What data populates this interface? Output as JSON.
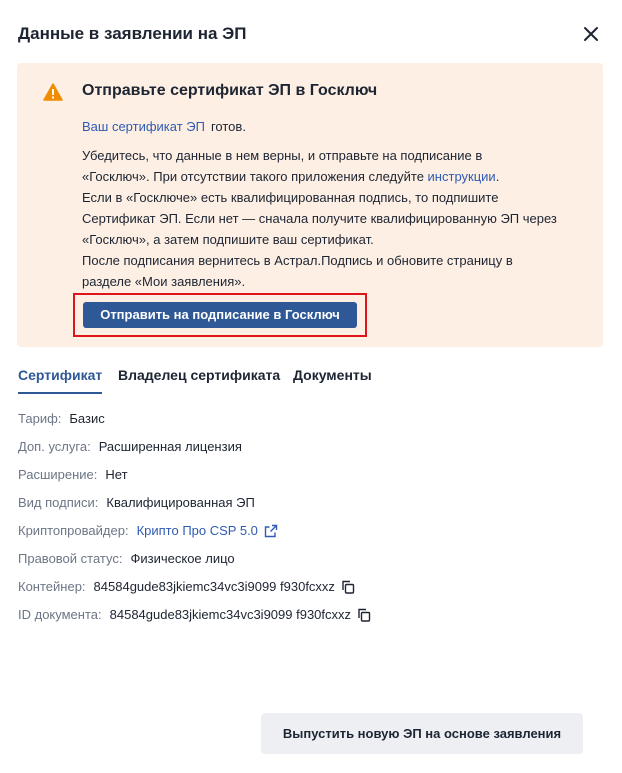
{
  "header": {
    "title": "Данные в заявлении на ЭП"
  },
  "alert": {
    "title": "Отправьте сертификат ЭП в Госключ",
    "cert_link": "Ваш сертификат ЭП",
    "cert_ready": "готов.",
    "line1_a": "Убедитесь, что данные в нем верны, и отправьте на подписание в",
    "line1_b": "«Госключ». При отсутствии такого приложения следуйте ",
    "instructions_link": "инструкции",
    "line1_end": ".",
    "line2": "Если в «Госключе» есть квалифицированная подпись, то подпишите Сертификат ЭП. Если нет — сначала получите квалифицированную ЭП через «Госключ», а затем подпишите ваш сертификат.",
    "line3": "После подписания вернитесь в Астрал.Подпись и обновите страницу в разделе «Мои заявления».",
    "send_button": "Отправить на подписание в Госключ"
  },
  "tabs": [
    {
      "label": "Сертификат",
      "active": true
    },
    {
      "label": "Владелец сертификата",
      "active": false
    },
    {
      "label": "Документы",
      "active": false
    }
  ],
  "info": {
    "tariff": {
      "label": "Тариф:",
      "value": "Базис"
    },
    "addon": {
      "label": "Доп. услуга:",
      "value": "Расширенная лицензия"
    },
    "extension": {
      "label": "Расширение:",
      "value": "Нет"
    },
    "signature": {
      "label": "Вид подписи:",
      "value": "Квалифицированная ЭП"
    },
    "crypto": {
      "label": "Криптопровайдер:",
      "value": "Крипто Про CSP 5.0"
    },
    "legal": {
      "label": "Правовой статус:",
      "value": "Физическое лицо"
    },
    "container": {
      "label": "Контейнер:",
      "value": "84584gude83jkiemc34vc3i9099 f930fcxxz"
    },
    "doc_id": {
      "label": "ID документа:",
      "value": "84584gude83jkiemc34vc3i9099 f930fcxxz"
    }
  },
  "footer": {
    "issue_button": "Выпустить новую ЭП на основе заявления"
  },
  "colors": {
    "accent": "#2f5897",
    "link": "#2f5bb3",
    "alert_bg": "#fdefe4",
    "warning": "#f08c00",
    "highlight": "#e0141b"
  },
  "icons": [
    "close-icon",
    "warning-icon",
    "external-link-icon",
    "copy-icon"
  ]
}
